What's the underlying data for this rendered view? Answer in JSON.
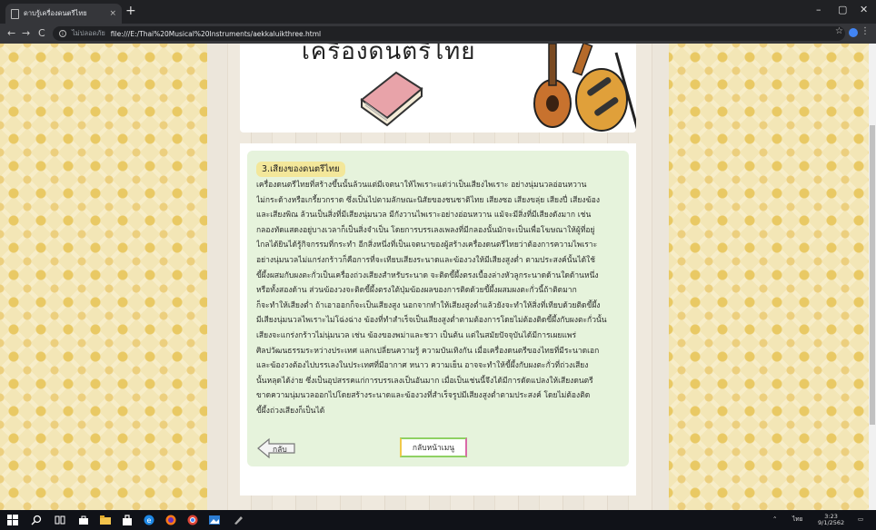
{
  "browser": {
    "tab_title": "ดาบรู้เครื่องดนตรีไทย",
    "tab_close": "×",
    "new_tab": "+",
    "omnibox_label": "ไม่ปลอดภัย",
    "url": "file:///E:/Thai%20Musical%20Instruments/aekkaluikthree.html",
    "back": "←",
    "forward": "→",
    "reload": "C",
    "star": "☆",
    "menu": "⋮",
    "minimize": "–",
    "restore": "▢",
    "close": "✕"
  },
  "page": {
    "header_title": "เครื่องดนตรีไทย",
    "section_heading": "3.เสียงของดนตรีไทย",
    "paragraph_lines": [
      "เครื่องดนตรีไทยที่สร้างขึ้นนั้นล้วนแต่มีเจตนาให้ไพเราะแต่ว่าเป็นเสียงไพเราะ อย่างนุ่มนวลอ่อนหวาน",
      "ไม่กระด้างหรือเกรี้ยวกราด ซึ่งเป็นไปตามลักษณะนิสัยของชนชาติไทย เสียงซอ เสียงขลุ่ย เสียงปี่ เสียงฆ้อง",
      "และเสียงพิณ ล้วนเป็นสิ่งที่มีเสียงนุ่มนวล มีกังวานไพเราะอย่างอ่อนหวาน แม้จะมีสิ่งที่มีเสียงดังมาก เช่น",
      "กลองทัดแสดงอยู่บางเวลาก็เป็นสิ่งจำเป็น โดยการบรรเลงเพลงที่มีกลองนั้นมักจะเป็นเพื่อโฆษณาให้ผู้ที่อยู่",
      "ไกลได้ยินได้รู้กิจกรรมที่กระทำ อีกสิ่งหนึ่งที่เป็นเจตนาของผู้สร้างเครื่องดนตรีไทยว่าต้องการความไพเราะ",
      "อย่างนุ่มนวลไม่แกร่งกร้าวก็คือการที่จะเทียบเสียงระนาดและฆ้องวงให้มีเสียงสูงต่ำ ตามประสงค์นั้นได้ใช้",
      "ขี้ผึ้งผสมกับผงตะกั่วเป็นเครื่องถ่วงเสียงสำหรับระนาด จะติดขี้ผึ้งตรงเบื้องล่างหัวลูกระนาดด้านใดด้านหนึ่ง",
      "หรือทั้งสองด้าน ส่วนฆ้องวงจะติดขี้ผึ้งตรงใต้ปุ่มฆ้องผลของการติดด้วยขี้ผึ้งผสมผงตะกั่วนี้ถ้าติดมาก",
      "ก็จะทำให้เสียงต่ำ ถ้าเอาออกก็จะเป็นเสียงสูง นอกจากทำให้เสียงสูงต่ำแล้วยังจะทำให้สิ่งที่เทียบด้วยติดขี้ผึ้ง",
      "มีเสียงนุ่มนวลไพเราะไม่โฉ่งฉ่าง ฆ้องที่ทำสำเร็จเป็นเสียงสูงต่ำตามต้องการโดยไม่ต้องติดขี้ผึ้งกับผงตะกั่วนั้น",
      "เสียงจะแกร่งกร้าวไม่นุ่มนวล เช่น ฆ้องของพม่าและชวา เป็นต้น แต่ในสมัยปัจจุบันได้มีการเผยแพร่",
      "ศิลปวัฒนธรรมระหว่างประเทศ แลกเปลี่ยนความรู้ ความบันเทิงกัน เมื่อเครื่องดนตรีของไทยที่มีระนาดเอก",
      "และฆ้องวงต้องไปบรรเลงในประเทศที่มีอากาศ หนาว ความเย็น อาจจะทำให้ขี้ผึ้งกับผงตะกั่วที่ถ่วงเสียง",
      "นั้นหลุดได้ง่าย ซึ่งเป็นอุปสรรคแก่การบรรเลงเป็นอันมาก เมื่อเป็นเช่นนี้จึงได้มีการดัดแปลงให้เสียงดนตรี",
      "ขาดความนุ่มนวลออกไปโดยสร้างระนาดและฆ้องวงที่สำเร็จรูปมีเสียงสูงต่ำตามประสงค์ โดยไม่ต้องติด",
      "ขี้ผึ้งถ่วงเสียงก็เป็นได้"
    ],
    "back_label": "กลับ",
    "main_menu_label": "กลับหน้าเมนู"
  },
  "taskbar": {
    "ime": "ไทย",
    "time": "3:23",
    "date": "9/1/2562"
  }
}
